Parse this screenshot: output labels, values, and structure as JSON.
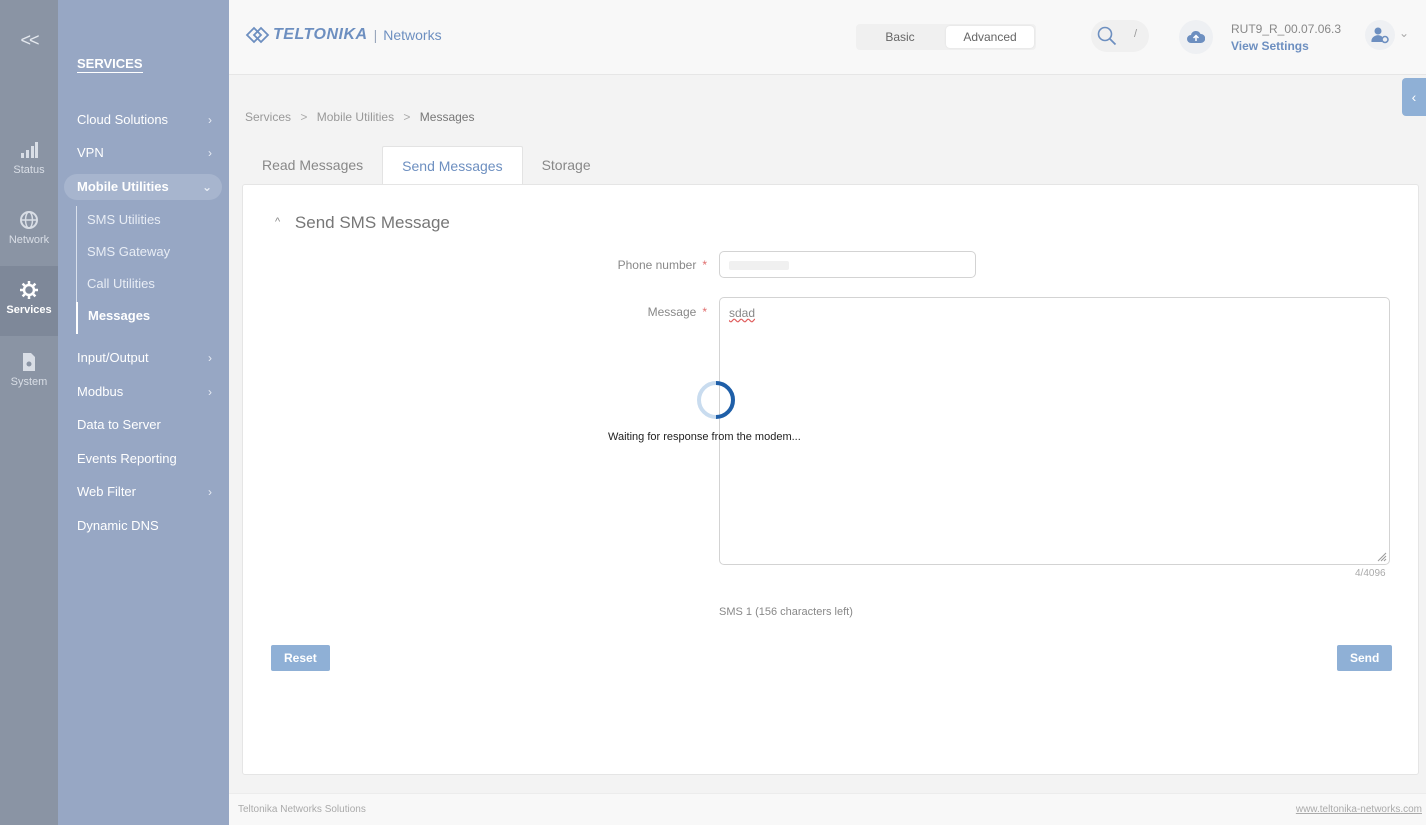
{
  "rail": {
    "collapse_label": "<<",
    "items": [
      {
        "label": "Status",
        "icon": "signal-bars-icon"
      },
      {
        "label": "Network",
        "icon": "globe-icon"
      },
      {
        "label": "Services",
        "icon": "gear-icon"
      },
      {
        "label": "System",
        "icon": "file-gear-icon"
      }
    ]
  },
  "sidebar": {
    "title": "SERVICES",
    "items": [
      {
        "label": "Cloud Solutions",
        "chevron": "›"
      },
      {
        "label": "VPN",
        "chevron": "›"
      },
      {
        "label": "Mobile Utilities",
        "chevron": "⌄"
      },
      {
        "label": "Input/Output",
        "chevron": "›"
      },
      {
        "label": "Modbus",
        "chevron": "›"
      },
      {
        "label": "Data to Server",
        "chevron": ""
      },
      {
        "label": "Events Reporting",
        "chevron": ""
      },
      {
        "label": "Web Filter",
        "chevron": "›"
      },
      {
        "label": "Dynamic DNS",
        "chevron": ""
      }
    ],
    "submenu": [
      "SMS Utilities",
      "SMS Gateway",
      "Call Utilities",
      "Messages"
    ]
  },
  "header": {
    "brand": "TELTONIKA",
    "brand_sep": "|",
    "brand_product": "Networks",
    "mode_basic": "Basic",
    "mode_advanced": "Advanced",
    "search_shortcut": "/",
    "firmware": "RUT9_R_00.07.06.3",
    "view_settings": "View Settings",
    "side_toggle": "‹"
  },
  "breadcrumb": {
    "items": [
      "Services",
      "Mobile Utilities",
      "Messages"
    ],
    "sep": ">"
  },
  "tabs": [
    "Read Messages",
    "Send Messages",
    "Storage"
  ],
  "form": {
    "title": "Send SMS Message",
    "title_caret": "^",
    "phone_label": "Phone number",
    "message_label": "Message",
    "required_mark": "*",
    "message_value": "sdad",
    "char_counter": "4/4096",
    "sms_info": "SMS 1 (156 characters left)",
    "reset_label": "Reset",
    "send_label": "Send"
  },
  "loading": {
    "text": "Waiting for response from the modem..."
  },
  "footer": {
    "left": "Teltonika Networks Solutions",
    "right": "www.teltonika-networks.com"
  },
  "colors": {
    "sidebar": "#97a7c4",
    "rail": "#8a94a4",
    "accent": "#6d8fc0",
    "button": "#8fb0d6",
    "spinner": "#1f5fa8"
  }
}
